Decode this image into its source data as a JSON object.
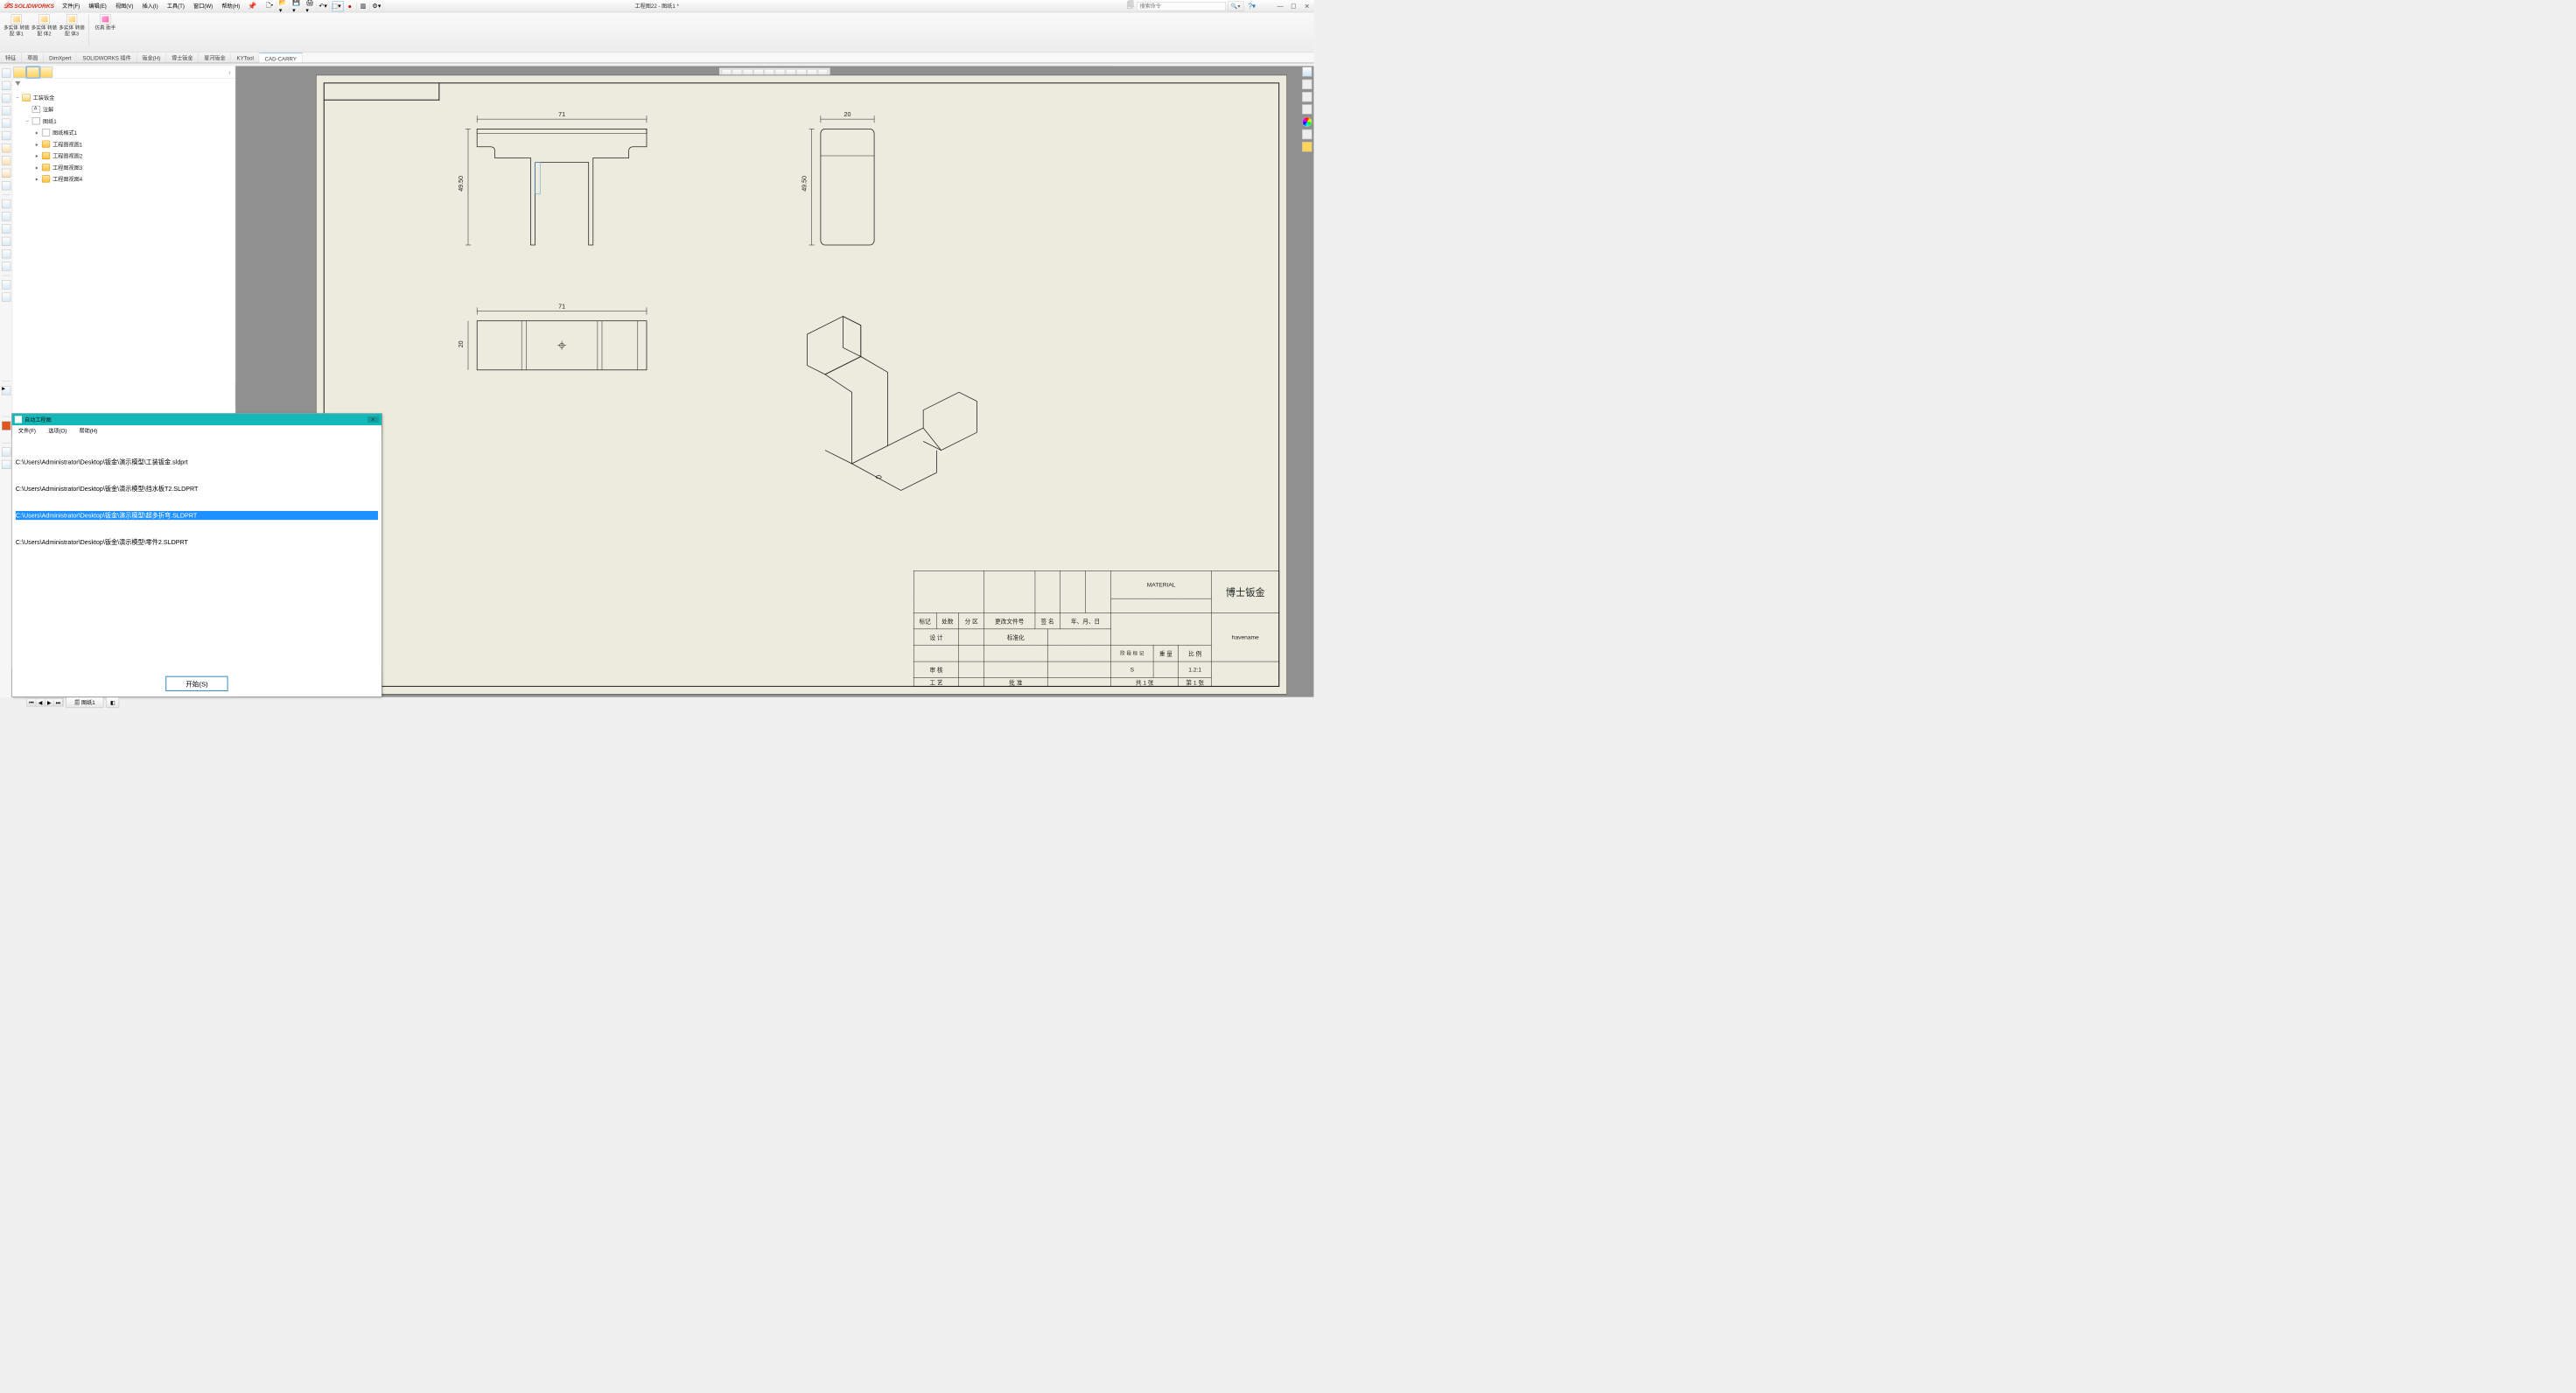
{
  "app": {
    "name": "SOLIDWORKS",
    "doc_title": "工程图22 - 图纸1 *"
  },
  "menu": {
    "file": "文件(F)",
    "edit": "编辑(E)",
    "view": "视图(V)",
    "insert": "插入(I)",
    "tools": "工具(T)",
    "window": "窗口(W)",
    "help": "帮助(H)"
  },
  "search": {
    "placeholder": "搜索命令"
  },
  "ribbon": {
    "g1": "多实体\n转装配\n体1",
    "g2": "多实体\n转装配\n体2",
    "g3": "多实体\n转装配\n体3",
    "g4": "仿真\n助手"
  },
  "cmtabs": [
    "特征",
    "草图",
    "DimXpert",
    "SOLIDWORKS 插件",
    "钣金(H)",
    "博士钣金",
    "星河钣金",
    "KYTool",
    "CAD-CARRY"
  ],
  "tree": {
    "root": "工装钣金",
    "annot": "注解",
    "sheet": "图纸1",
    "format": "图纸格式1",
    "v1": "工程图视图1",
    "v2": "工程图视图2",
    "v3": "工程图视图3",
    "v4": "工程图视图4"
  },
  "dims": {
    "w71": "71",
    "h49_50": "49.50",
    "d20": "20"
  },
  "titleblock": {
    "material": "MATERIAL",
    "brand": "博士钣金",
    "havename": "havename",
    "hdr_mark": "标记",
    "hdr_place": "处数",
    "hdr_zone": "分 区",
    "hdr_file": "更改文件号",
    "hdr_sign": "签 名",
    "hdr_date": "年、月、日",
    "design": "设 计",
    "std": "标准化",
    "stage": "阶 段 标 记",
    "weight": "重 量",
    "scale": "比 例",
    "scale_val": "1.2:1",
    "s": "S",
    "check": "审 核",
    "process": "工 艺",
    "approve": "批 准",
    "page": "共 1 张",
    "page2": "第 1 张"
  },
  "modal": {
    "title": "自动工程图",
    "menu_file": "文件(F)",
    "menu_option": "选项(O)",
    "menu_help": "帮助(H)",
    "files": [
      "C:\\Users\\Administrator\\Desktop\\钣金\\演示模型\\工装钣金.sldprt",
      "C:\\Users\\Administrator\\Desktop\\钣金\\演示模型\\挡水板T2.SLDPRT",
      "C:\\Users\\Administrator\\Desktop\\钣金\\演示模型\\超多折弯.SLDPRT",
      "C:\\Users\\Administrator\\Desktop\\钣金\\演示模型\\零件2.SLDPRT"
    ],
    "start": "开始(S)"
  },
  "bottom": {
    "sheet": "图纸1"
  }
}
